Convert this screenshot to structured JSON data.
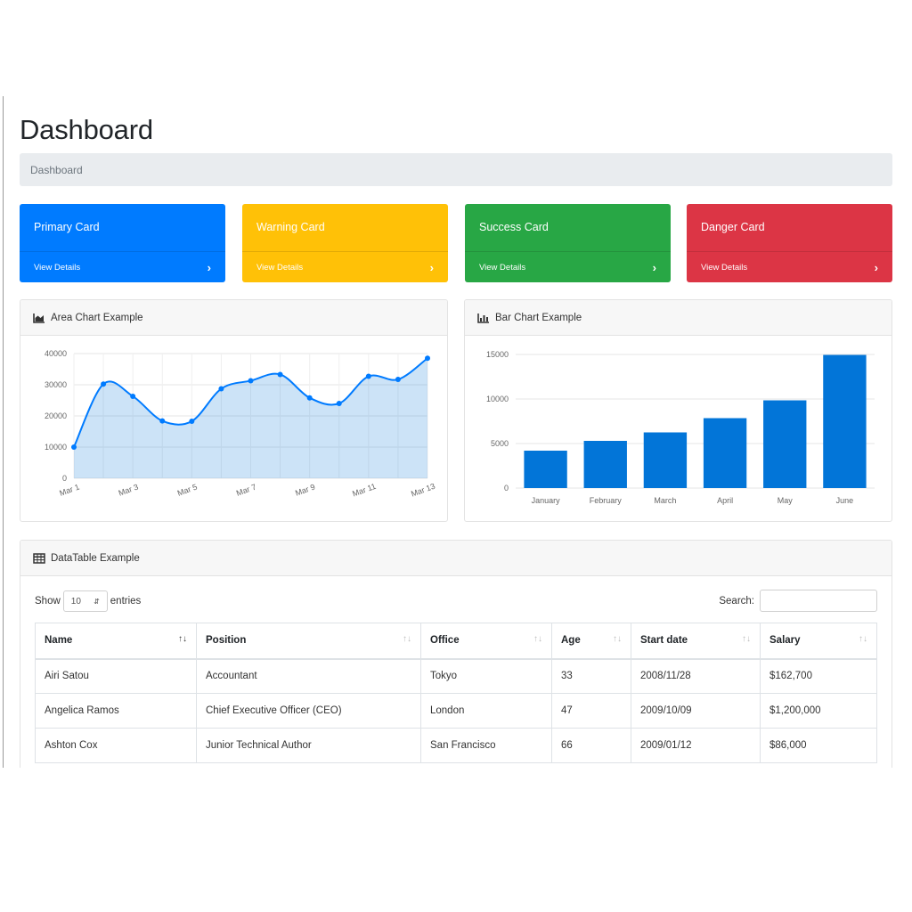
{
  "page": {
    "title": "Dashboard",
    "breadcrumb": "Dashboard"
  },
  "cards": [
    {
      "title": "Primary Card",
      "link": "View Details",
      "color": "#007bff"
    },
    {
      "title": "Warning Card",
      "link": "View Details",
      "color": "#ffc107"
    },
    {
      "title": "Success Card",
      "link": "View Details",
      "color": "#28a745"
    },
    {
      "title": "Danger Card",
      "link": "View Details",
      "color": "#dc3545"
    }
  ],
  "area_chart_panel": {
    "title": "Area Chart Example",
    "icon": "area-chart-icon"
  },
  "bar_chart_panel": {
    "title": "Bar Chart Example",
    "icon": "bar-chart-icon"
  },
  "chart_data": [
    {
      "type": "area",
      "x": [
        "Mar 1",
        "Mar 2",
        "Mar 3",
        "Mar 4",
        "Mar 5",
        "Mar 6",
        "Mar 7",
        "Mar 8",
        "Mar 9",
        "Mar 10",
        "Mar 11",
        "Mar 12",
        "Mar 13"
      ],
      "x_tick_labels": [
        "Mar 1",
        "Mar 3",
        "Mar 5",
        "Mar 7",
        "Mar 9",
        "Mar 11",
        "Mar 13"
      ],
      "values": [
        10000,
        30200,
        26300,
        18400,
        18300,
        28700,
        31300,
        33300,
        25800,
        24000,
        32700,
        31700,
        38500
      ],
      "ylim": [
        0,
        40000
      ],
      "yticks": [
        0,
        10000,
        20000,
        30000,
        40000
      ],
      "grid": true,
      "color": "#007bff"
    },
    {
      "type": "bar",
      "categories": [
        "January",
        "February",
        "March",
        "April",
        "May",
        "June"
      ],
      "values": [
        4200,
        5300,
        6250,
        7850,
        9850,
        14950
      ],
      "ylim": [
        0,
        15000
      ],
      "yticks": [
        0,
        5000,
        10000,
        15000
      ],
      "grid": true,
      "color": "#0275d8"
    }
  ],
  "datatable": {
    "title": "DataTable Example",
    "icon": "table-icon",
    "show_label": "Show",
    "entries_label": "entries",
    "page_size": "10",
    "search_label": "Search:",
    "search_value": "",
    "columns": [
      "Name",
      "Position",
      "Office",
      "Age",
      "Start date",
      "Salary"
    ],
    "rows": [
      [
        "Airi Satou",
        "Accountant",
        "Tokyo",
        "33",
        "2008/11/28",
        "$162,700"
      ],
      [
        "Angelica Ramos",
        "Chief Executive Officer (CEO)",
        "London",
        "47",
        "2009/10/09",
        "$1,200,000"
      ],
      [
        "Ashton Cox",
        "Junior Technical Author",
        "San Francisco",
        "66",
        "2009/01/12",
        "$86,000"
      ]
    ]
  }
}
